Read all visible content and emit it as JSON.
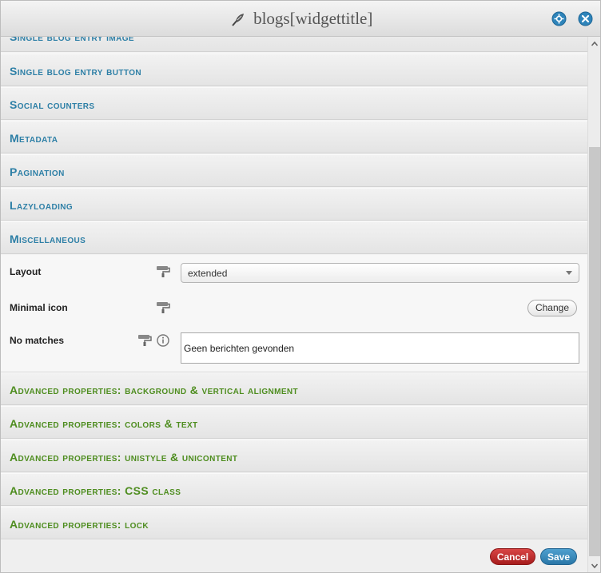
{
  "window": {
    "title": "blogs[widgettitle]",
    "title_icon": "feather-icon",
    "maximize_icon": "maximize-icon",
    "close_icon": "close-icon"
  },
  "sections_top": [
    {
      "label": "Single blog entry image"
    },
    {
      "label": "Single blog entry button"
    },
    {
      "label": "Social counters"
    },
    {
      "label": "Metadata"
    },
    {
      "label": "Pagination"
    },
    {
      "label": "Lazyloading"
    },
    {
      "label": "Miscellaneous"
    }
  ],
  "properties": {
    "layout": {
      "label": "Layout",
      "value": "extended"
    },
    "minimal_icon": {
      "label": "Minimal icon",
      "button": "Change"
    },
    "no_matches": {
      "label": "No matches",
      "value": "Geen berichten gevonden"
    }
  },
  "sections_advanced": [
    {
      "label": "Advanced properties: background & vertical alignment"
    },
    {
      "label": "Advanced properties: colors & text"
    },
    {
      "label": "Advanced properties: unistyle & unicontent"
    },
    {
      "label": "Advanced properties: CSS class"
    },
    {
      "label": "Advanced properties: lock"
    }
  ],
  "footer": {
    "cancel": "Cancel",
    "save": "Save"
  },
  "colors": {
    "section_label": "#2d7fa6",
    "advanced_label": "#4e8d1f",
    "cancel_button": "#b32727",
    "save_button": "#3587bb"
  }
}
